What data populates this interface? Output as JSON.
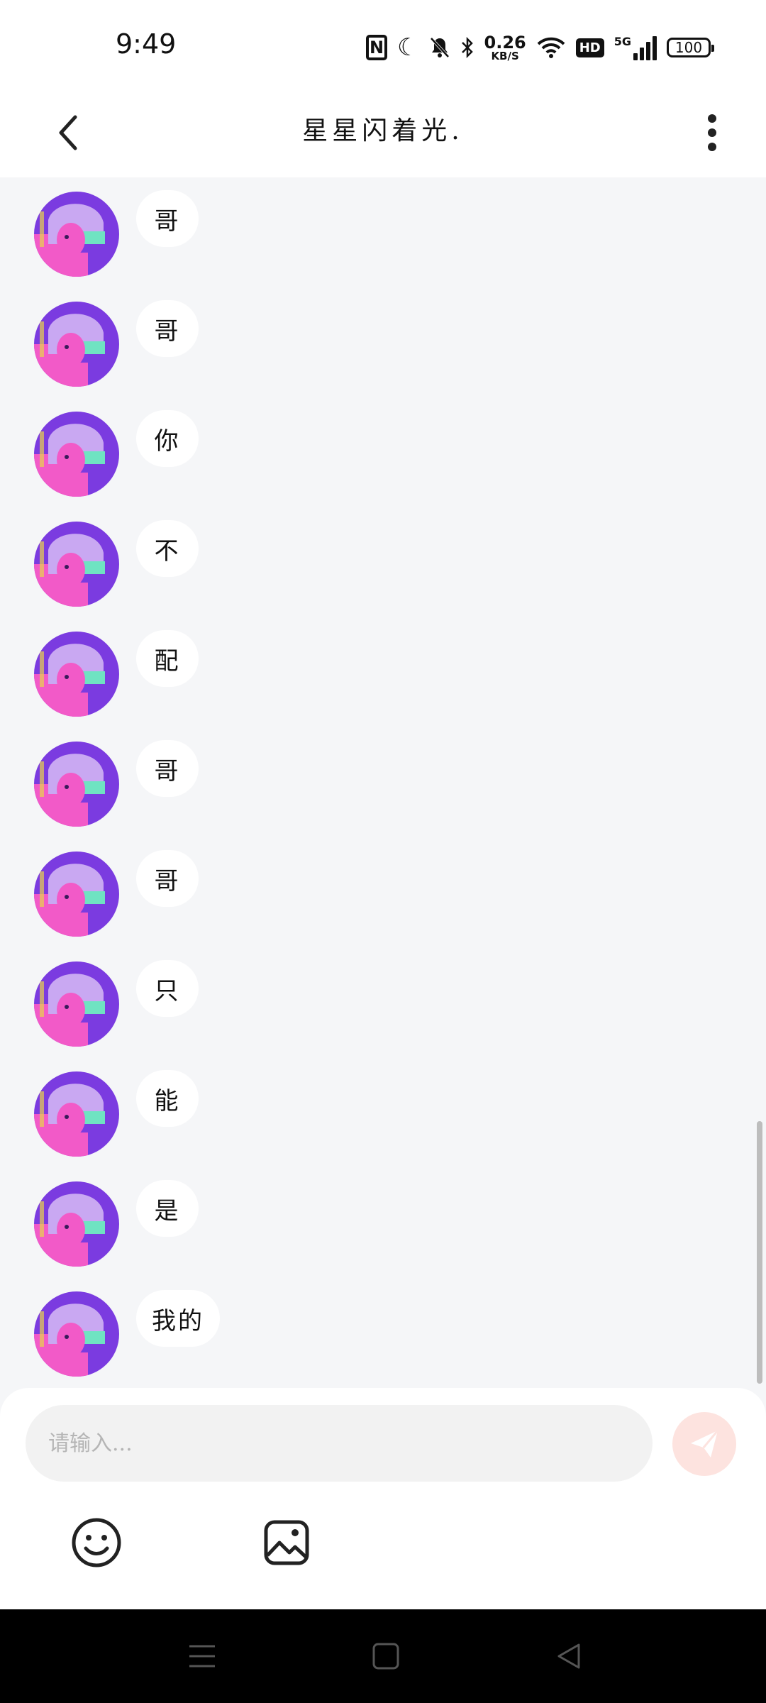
{
  "status_bar": {
    "time": "9:49",
    "net_speed_value": "0.26",
    "net_speed_unit": "KB/S",
    "hd_label": "HD",
    "signal_label": "5G",
    "battery": "100",
    "icons": [
      "nfc-icon",
      "moon-icon",
      "bell-off-icon",
      "bluetooth-icon",
      "wifi-icon",
      "signal-icon",
      "battery-icon"
    ]
  },
  "header": {
    "title": "星星闪着光.",
    "back_icon": "chevron-left-icon",
    "more_icon": "more-vertical-icon"
  },
  "messages": [
    {
      "text": "哥"
    },
    {
      "text": "哥"
    },
    {
      "text": "你"
    },
    {
      "text": "不"
    },
    {
      "text": "配"
    },
    {
      "text": "哥"
    },
    {
      "text": "哥"
    },
    {
      "text": "只"
    },
    {
      "text": "能"
    },
    {
      "text": "是"
    },
    {
      "text": "我的"
    }
  ],
  "composer": {
    "placeholder": "请输入...",
    "send_icon": "send-icon",
    "emoji_icon": "smiley-icon",
    "image_icon": "image-icon"
  },
  "colors": {
    "background": "#f5f6f8",
    "bubble": "#ffffff",
    "send_button": "#fde3df",
    "send_icon": "#ffffff",
    "avatar_pink": "#f25ac8",
    "avatar_purple": "#7b3be0",
    "avatar_hair": "#c9a8f2",
    "avatar_teal": "#6fe3c2"
  },
  "nav_bar": {
    "icons": [
      "menu-icon",
      "home-square-icon",
      "back-triangle-icon"
    ]
  }
}
